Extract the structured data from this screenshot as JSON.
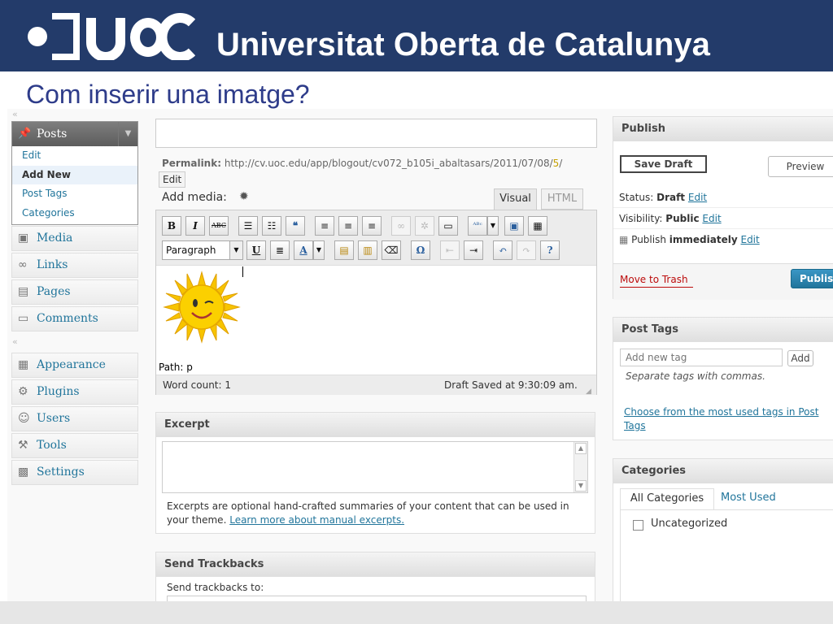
{
  "header": {
    "university": "Universitat Oberta de Catalunya",
    "slide_title": "Com inserir una imatge?"
  },
  "colors": {
    "header_bg": "#233b6a",
    "accent_blue": "#21759b",
    "publish_btn": "#2583ad",
    "trash_red": "#bc0b0b"
  },
  "sidebar": {
    "posts_label": "Posts",
    "posts_sub": [
      "Edit",
      "Add New",
      "Post Tags",
      "Categories"
    ],
    "items": [
      "Media",
      "Links",
      "Pages",
      "Comments",
      "Appearance",
      "Plugins",
      "Users",
      "Tools",
      "Settings"
    ]
  },
  "editor": {
    "permalink_label": "Permalink:",
    "permalink_base": "http://cv.uoc.edu/app/blogout/cv072_b105i_abaltasars/2011/07/08/",
    "permalink_slug": "5",
    "permalink_end": "/",
    "edit_label": "Edit",
    "add_media": "Add media:",
    "tab_visual": "Visual",
    "tab_html": "HTML",
    "format_select": "Paragraph",
    "path": "Path: p",
    "word_count": "Word count: 1",
    "draft_saved": "Draft Saved at 9:30:09 am."
  },
  "excerpt": {
    "title": "Excerpt",
    "help": "Excerpts are optional hand-crafted summaries of your content that can be used in your theme.",
    "link": "Learn more about manual excerpts."
  },
  "trackbacks": {
    "title": "Send Trackbacks",
    "label": "Send trackbacks to:"
  },
  "publish": {
    "title": "Publish",
    "save_draft": "Save Draft",
    "preview": "Preview",
    "status_label": "Status:",
    "status_value": "Draft",
    "visibility_label": "Visibility:",
    "visibility_value": "Public",
    "publish_label": "Publish",
    "publish_value": "immediately",
    "edit": "Edit",
    "move_to_trash": "Move to Trash",
    "publish_btn": "Publis"
  },
  "tags": {
    "title": "Post Tags",
    "placeholder": "Add new tag",
    "add": "Add",
    "hint": "Separate tags with commas.",
    "choose_line1": "Choose from the most used tags in Post",
    "choose_line2": "Tags"
  },
  "categories": {
    "title": "Categories",
    "tab_all": "All Categories",
    "tab_most": "Most Used",
    "item": "Uncategorized"
  }
}
